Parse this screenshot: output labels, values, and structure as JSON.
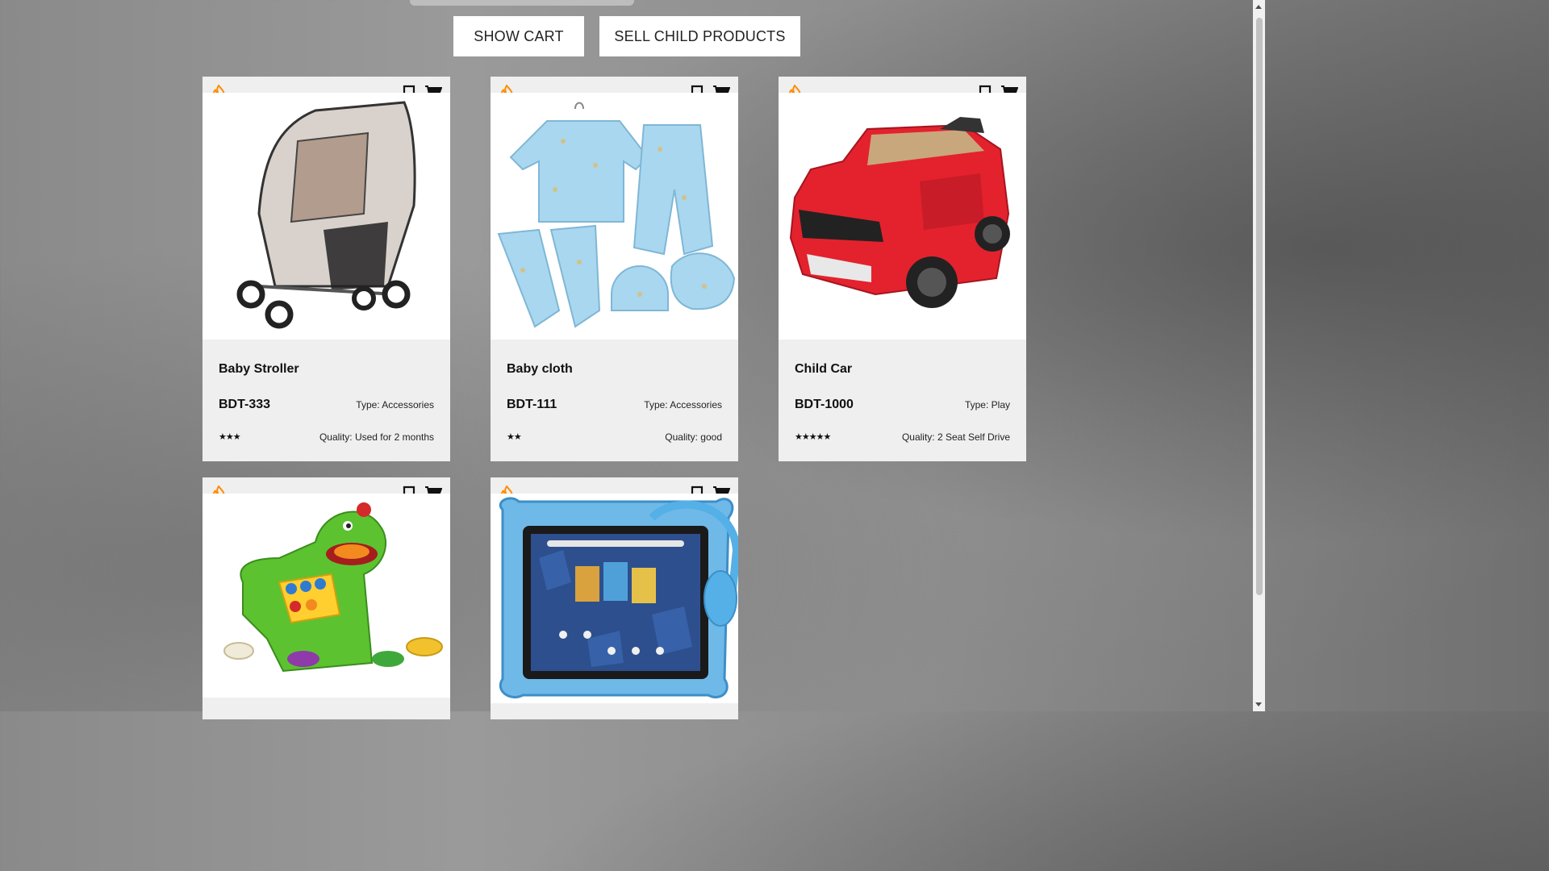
{
  "toolbar": {
    "show_cart_label": "SHOW CART",
    "sell_label": "SELL CHILD PRODUCTS"
  },
  "colors": {
    "fire": "#ff8c00",
    "card_bg": "#efefef"
  },
  "products": [
    {
      "name": "Baby Stroller",
      "price": "BDT-333",
      "type": "Type: Accessories",
      "rating": 3,
      "stars": "★★★",
      "quality": "Quality: Used for 2 months"
    },
    {
      "name": "Baby cloth",
      "price": "BDT-111",
      "type": "Type: Accessories",
      "rating": 2,
      "stars": "★★",
      "quality": "Quality: good"
    },
    {
      "name": "Child Car",
      "price": "BDT-1000",
      "type": "Type: Play",
      "rating": 5,
      "stars": "★★★★★",
      "quality": "Quality: 2 Seat Self Drive"
    },
    {
      "name": "",
      "image": "dinosaur-toy"
    },
    {
      "name": "",
      "image": "kids-tablet"
    }
  ]
}
